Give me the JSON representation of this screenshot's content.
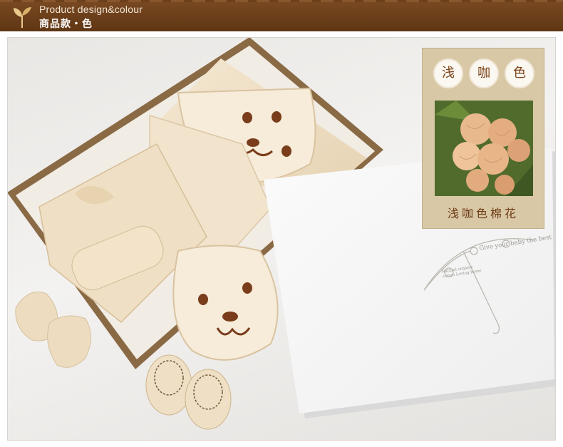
{
  "header": {
    "title_en": "Product design&colour",
    "title_cn": "商品款・色",
    "leaf_icon": "sprout-leaf-icon",
    "bg_color": "#6b3e19"
  },
  "badge": {
    "chars": [
      "浅",
      "咖",
      "色"
    ],
    "caption": "浅咖色棉花",
    "accent": "#7b4316"
  },
  "giftbox": {
    "slogan": "Give your baby the best",
    "small_text": "Natural organic cotton Loving home"
  }
}
